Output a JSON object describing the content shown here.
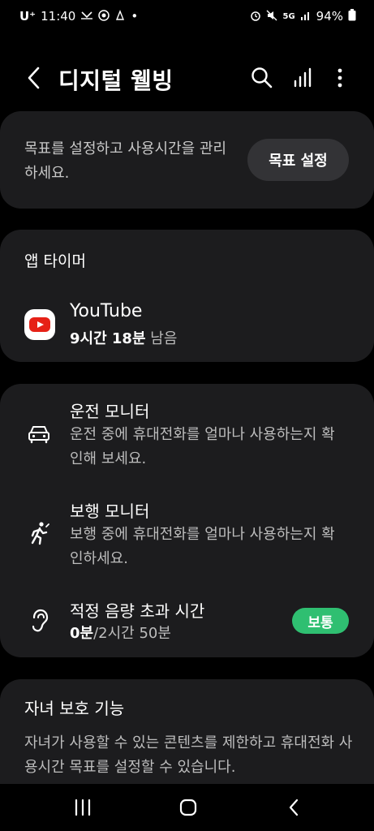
{
  "status_bar": {
    "carrier": "U⁺",
    "time": "11:40",
    "dot": "•",
    "network": "5G",
    "battery_pct": "94%"
  },
  "app_bar": {
    "title": "디지털 웰빙"
  },
  "goal_card": {
    "text": "목표를 설정하고 사용시간을 관리하세요.",
    "button_label": "목표 설정"
  },
  "app_timer": {
    "section_title": "앱 타이머",
    "app_name": "YouTube",
    "time_remaining": "9시간 18분",
    "remaining_suffix": "남음"
  },
  "monitors": {
    "driving": {
      "title": "운전 모니터",
      "description": "운전 중에 휴대전화를 얼마나 사용하는지 확인해 보세요."
    },
    "walking": {
      "title": "보행 모니터",
      "description": "보행 중에 휴대전화를 얼마나 사용하는지 확인하세요."
    },
    "volume": {
      "title": "적정 음량 초과 시간",
      "current": "0분",
      "limit": "/2시간 50분",
      "badge": "보통"
    }
  },
  "parental": {
    "title": "자녀 보호 기능",
    "description": "자녀가 사용할 수 있는 콘텐츠를 제한하고 휴대전화 사용시간 목표를 설정할 수 있습니다."
  },
  "colors": {
    "background": "#000000",
    "card": "#1c1c1e",
    "badge_green": "#2fbf71",
    "youtube_red": "#e62117"
  }
}
